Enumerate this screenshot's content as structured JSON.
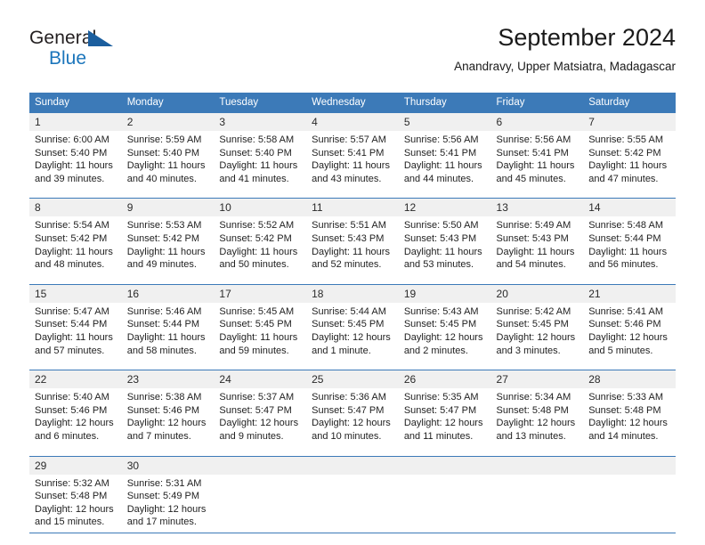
{
  "brand": {
    "name_part1": "General",
    "name_part2": "Blue",
    "triangle_icon": "triangle-icon",
    "accent_blue": "#1b75bb",
    "dark_blue": "#1b5e9e"
  },
  "header": {
    "title": "September 2024",
    "subtitle": "Anandravy, Upper Matsiatra, Madagascar"
  },
  "calendar": {
    "header_bg": "#3c7ab8",
    "daynum_bg": "#f0f0f0",
    "weekday_headers": [
      "Sunday",
      "Monday",
      "Tuesday",
      "Wednesday",
      "Thursday",
      "Friday",
      "Saturday"
    ],
    "weeks": [
      [
        {
          "day": "1",
          "sunrise": "Sunrise: 6:00 AM",
          "sunset": "Sunset: 5:40 PM",
          "daylight1": "Daylight: 11 hours",
          "daylight2": "and 39 minutes."
        },
        {
          "day": "2",
          "sunrise": "Sunrise: 5:59 AM",
          "sunset": "Sunset: 5:40 PM",
          "daylight1": "Daylight: 11 hours",
          "daylight2": "and 40 minutes."
        },
        {
          "day": "3",
          "sunrise": "Sunrise: 5:58 AM",
          "sunset": "Sunset: 5:40 PM",
          "daylight1": "Daylight: 11 hours",
          "daylight2": "and 41 minutes."
        },
        {
          "day": "4",
          "sunrise": "Sunrise: 5:57 AM",
          "sunset": "Sunset: 5:41 PM",
          "daylight1": "Daylight: 11 hours",
          "daylight2": "and 43 minutes."
        },
        {
          "day": "5",
          "sunrise": "Sunrise: 5:56 AM",
          "sunset": "Sunset: 5:41 PM",
          "daylight1": "Daylight: 11 hours",
          "daylight2": "and 44 minutes."
        },
        {
          "day": "6",
          "sunrise": "Sunrise: 5:56 AM",
          "sunset": "Sunset: 5:41 PM",
          "daylight1": "Daylight: 11 hours",
          "daylight2": "and 45 minutes."
        },
        {
          "day": "7",
          "sunrise": "Sunrise: 5:55 AM",
          "sunset": "Sunset: 5:42 PM",
          "daylight1": "Daylight: 11 hours",
          "daylight2": "and 47 minutes."
        }
      ],
      [
        {
          "day": "8",
          "sunrise": "Sunrise: 5:54 AM",
          "sunset": "Sunset: 5:42 PM",
          "daylight1": "Daylight: 11 hours",
          "daylight2": "and 48 minutes."
        },
        {
          "day": "9",
          "sunrise": "Sunrise: 5:53 AM",
          "sunset": "Sunset: 5:42 PM",
          "daylight1": "Daylight: 11 hours",
          "daylight2": "and 49 minutes."
        },
        {
          "day": "10",
          "sunrise": "Sunrise: 5:52 AM",
          "sunset": "Sunset: 5:42 PM",
          "daylight1": "Daylight: 11 hours",
          "daylight2": "and 50 minutes."
        },
        {
          "day": "11",
          "sunrise": "Sunrise: 5:51 AM",
          "sunset": "Sunset: 5:43 PM",
          "daylight1": "Daylight: 11 hours",
          "daylight2": "and 52 minutes."
        },
        {
          "day": "12",
          "sunrise": "Sunrise: 5:50 AM",
          "sunset": "Sunset: 5:43 PM",
          "daylight1": "Daylight: 11 hours",
          "daylight2": "and 53 minutes."
        },
        {
          "day": "13",
          "sunrise": "Sunrise: 5:49 AM",
          "sunset": "Sunset: 5:43 PM",
          "daylight1": "Daylight: 11 hours",
          "daylight2": "and 54 minutes."
        },
        {
          "day": "14",
          "sunrise": "Sunrise: 5:48 AM",
          "sunset": "Sunset: 5:44 PM",
          "daylight1": "Daylight: 11 hours",
          "daylight2": "and 56 minutes."
        }
      ],
      [
        {
          "day": "15",
          "sunrise": "Sunrise: 5:47 AM",
          "sunset": "Sunset: 5:44 PM",
          "daylight1": "Daylight: 11 hours",
          "daylight2": "and 57 minutes."
        },
        {
          "day": "16",
          "sunrise": "Sunrise: 5:46 AM",
          "sunset": "Sunset: 5:44 PM",
          "daylight1": "Daylight: 11 hours",
          "daylight2": "and 58 minutes."
        },
        {
          "day": "17",
          "sunrise": "Sunrise: 5:45 AM",
          "sunset": "Sunset: 5:45 PM",
          "daylight1": "Daylight: 11 hours",
          "daylight2": "and 59 minutes."
        },
        {
          "day": "18",
          "sunrise": "Sunrise: 5:44 AM",
          "sunset": "Sunset: 5:45 PM",
          "daylight1": "Daylight: 12 hours",
          "daylight2": "and 1 minute."
        },
        {
          "day": "19",
          "sunrise": "Sunrise: 5:43 AM",
          "sunset": "Sunset: 5:45 PM",
          "daylight1": "Daylight: 12 hours",
          "daylight2": "and 2 minutes."
        },
        {
          "day": "20",
          "sunrise": "Sunrise: 5:42 AM",
          "sunset": "Sunset: 5:45 PM",
          "daylight1": "Daylight: 12 hours",
          "daylight2": "and 3 minutes."
        },
        {
          "day": "21",
          "sunrise": "Sunrise: 5:41 AM",
          "sunset": "Sunset: 5:46 PM",
          "daylight1": "Daylight: 12 hours",
          "daylight2": "and 5 minutes."
        }
      ],
      [
        {
          "day": "22",
          "sunrise": "Sunrise: 5:40 AM",
          "sunset": "Sunset: 5:46 PM",
          "daylight1": "Daylight: 12 hours",
          "daylight2": "and 6 minutes."
        },
        {
          "day": "23",
          "sunrise": "Sunrise: 5:38 AM",
          "sunset": "Sunset: 5:46 PM",
          "daylight1": "Daylight: 12 hours",
          "daylight2": "and 7 minutes."
        },
        {
          "day": "24",
          "sunrise": "Sunrise: 5:37 AM",
          "sunset": "Sunset: 5:47 PM",
          "daylight1": "Daylight: 12 hours",
          "daylight2": "and 9 minutes."
        },
        {
          "day": "25",
          "sunrise": "Sunrise: 5:36 AM",
          "sunset": "Sunset: 5:47 PM",
          "daylight1": "Daylight: 12 hours",
          "daylight2": "and 10 minutes."
        },
        {
          "day": "26",
          "sunrise": "Sunrise: 5:35 AM",
          "sunset": "Sunset: 5:47 PM",
          "daylight1": "Daylight: 12 hours",
          "daylight2": "and 11 minutes."
        },
        {
          "day": "27",
          "sunrise": "Sunrise: 5:34 AM",
          "sunset": "Sunset: 5:48 PM",
          "daylight1": "Daylight: 12 hours",
          "daylight2": "and 13 minutes."
        },
        {
          "day": "28",
          "sunrise": "Sunrise: 5:33 AM",
          "sunset": "Sunset: 5:48 PM",
          "daylight1": "Daylight: 12 hours",
          "daylight2": "and 14 minutes."
        }
      ],
      [
        {
          "day": "29",
          "sunrise": "Sunrise: 5:32 AM",
          "sunset": "Sunset: 5:48 PM",
          "daylight1": "Daylight: 12 hours",
          "daylight2": "and 15 minutes."
        },
        {
          "day": "30",
          "sunrise": "Sunrise: 5:31 AM",
          "sunset": "Sunset: 5:49 PM",
          "daylight1": "Daylight: 12 hours",
          "daylight2": "and 17 minutes."
        },
        {
          "day": "",
          "sunrise": "",
          "sunset": "",
          "daylight1": "",
          "daylight2": ""
        },
        {
          "day": "",
          "sunrise": "",
          "sunset": "",
          "daylight1": "",
          "daylight2": ""
        },
        {
          "day": "",
          "sunrise": "",
          "sunset": "",
          "daylight1": "",
          "daylight2": ""
        },
        {
          "day": "",
          "sunrise": "",
          "sunset": "",
          "daylight1": "",
          "daylight2": ""
        },
        {
          "day": "",
          "sunrise": "",
          "sunset": "",
          "daylight1": "",
          "daylight2": ""
        }
      ]
    ]
  }
}
